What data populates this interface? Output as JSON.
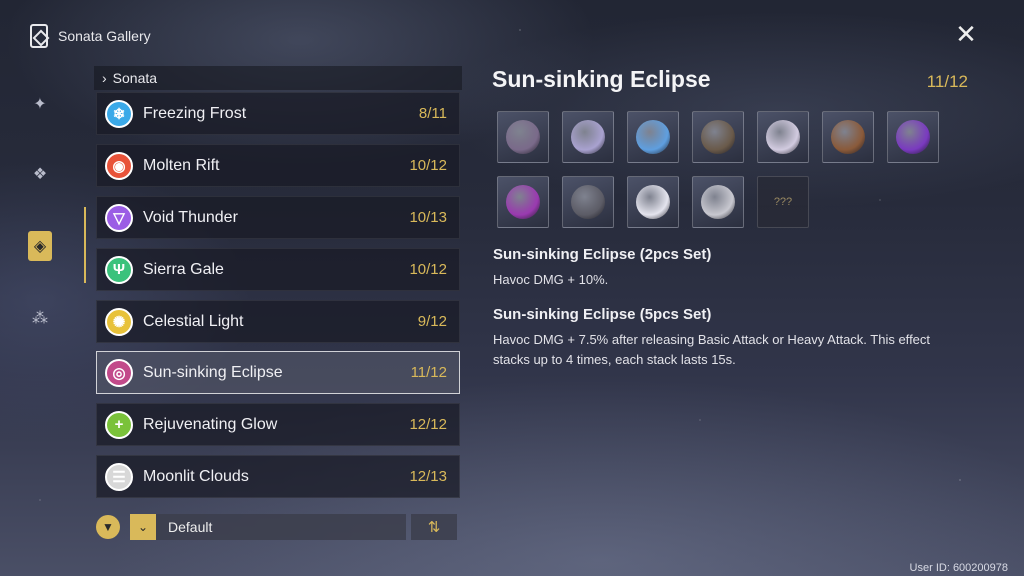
{
  "header": {
    "title": "Sonata Gallery"
  },
  "nav": {
    "items": [
      {
        "icon": "crystal-icon",
        "glyph": "✦"
      },
      {
        "icon": "echo-stack-icon",
        "glyph": "❖"
      },
      {
        "icon": "sonata-card-icon",
        "glyph": "◈",
        "active": true
      },
      {
        "icon": "constellation-icon",
        "glyph": "⁂"
      }
    ]
  },
  "list": {
    "section_label": "Sonata",
    "items": [
      {
        "name": "Freezing Frost",
        "count": "8/11",
        "color": "#3aa9e8",
        "glyph": "❄"
      },
      {
        "name": "Molten Rift",
        "count": "10/12",
        "color": "#e8533a",
        "glyph": "◉"
      },
      {
        "name": "Void Thunder",
        "count": "10/13",
        "color": "#9b5de5",
        "glyph": "▽"
      },
      {
        "name": "Sierra Gale",
        "count": "10/12",
        "color": "#3ac27c",
        "glyph": "Ψ"
      },
      {
        "name": "Celestial Light",
        "count": "9/12",
        "color": "#e8c23a",
        "glyph": "✺"
      },
      {
        "name": "Sun-sinking Eclipse",
        "count": "11/12",
        "color": "#c24a8a",
        "glyph": "◎",
        "selected": true
      },
      {
        "name": "Rejuvenating Glow",
        "count": "12/12",
        "color": "#7ac23a",
        "glyph": "+"
      },
      {
        "name": "Moonlit Clouds",
        "count": "12/13",
        "color": "#d8d8d8",
        "glyph": "☰"
      }
    ]
  },
  "filter": {
    "sort_label": "Default",
    "order_glyph": "⇅"
  },
  "detail": {
    "title": "Sun-sinking Eclipse",
    "count": "11/12",
    "echoes": [
      {
        "color": "#7a6a8a"
      },
      {
        "color": "#a9a2d0"
      },
      {
        "color": "#5f9fe0"
      },
      {
        "color": "#6a5a4a"
      },
      {
        "color": "#d2cbe0"
      },
      {
        "color": "#8a5a3a"
      },
      {
        "color": "#7a3ac0"
      },
      {
        "color": "#9a3ab0"
      },
      {
        "color": "#5c5c66"
      },
      {
        "color": "#e4e4ee"
      },
      {
        "color": "#c8c8d0"
      },
      {
        "unknown": true,
        "label": "???"
      }
    ],
    "set2_title": "Sun-sinking Eclipse (2pcs Set)",
    "set2_desc": "Havoc DMG + 10%.",
    "set5_title": "Sun-sinking Eclipse (5pcs Set)",
    "set5_desc": "Havoc DMG + 7.5% after releasing Basic Attack or Heavy Attack. This effect stacks up to 4 times, each stack lasts 15s."
  },
  "footer": {
    "user_id": "User ID: 600200978"
  }
}
